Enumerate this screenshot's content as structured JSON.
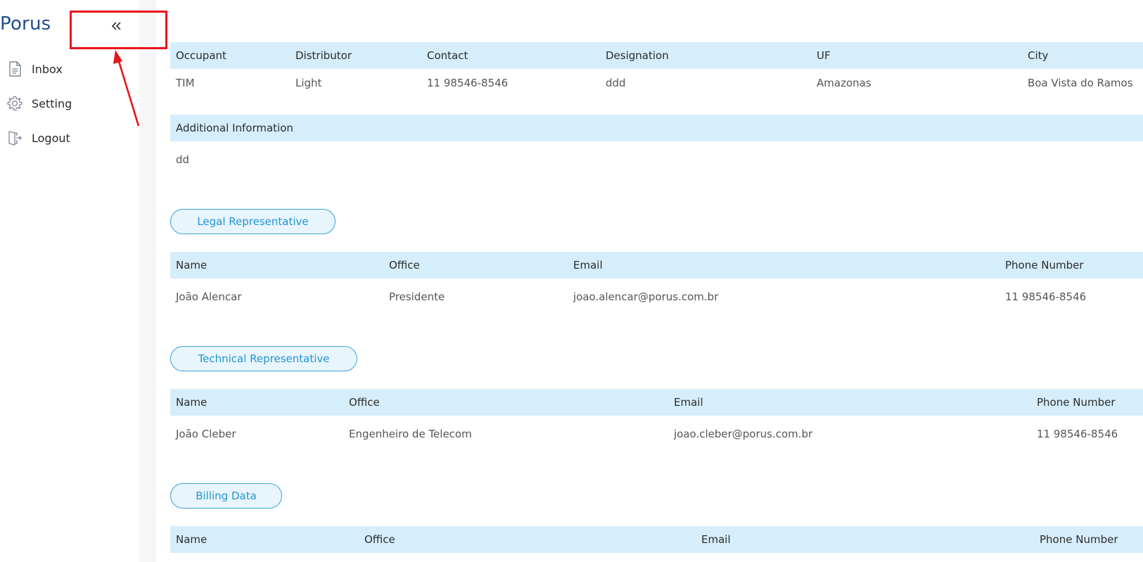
{
  "sidebar": {
    "brand": "Porus",
    "items": [
      {
        "label": "Inbox",
        "icon": "document-icon"
      },
      {
        "label": "Setting",
        "icon": "gear-icon"
      },
      {
        "label": "Logout",
        "icon": "logout-icon"
      }
    ],
    "collapse_icon": "double-chevron-left-icon"
  },
  "annotation": {
    "color": "#e8141b"
  },
  "occupant_table": {
    "headers": [
      "Occupant",
      "Distributor",
      "Contact",
      "Designation",
      "UF",
      "City"
    ],
    "row": [
      "TIM",
      "Light",
      "11 98546-8546",
      "ddd",
      "Amazonas",
      "Boa Vista do Ramos"
    ]
  },
  "additional_info": {
    "header": "Additional Information",
    "value": "dd"
  },
  "legal_representative": {
    "title": "Legal Representative",
    "headers": [
      "Name",
      "Office",
      "Email",
      "Phone Number"
    ],
    "row": [
      "João Alencar",
      "Presidente",
      "joao.alencar@porus.com.br",
      "11 98546-8546"
    ]
  },
  "technical_representative": {
    "title": "Technical Representative",
    "headers": [
      "Name",
      "Office",
      "Email",
      "Phone Number"
    ],
    "row": [
      "João Cleber",
      "Engenheiro de Telecom",
      "joao.cleber@porus.com.br",
      "11 98546-8546"
    ]
  },
  "billing_data": {
    "title": "Billing Data",
    "headers": [
      "Name",
      "Office",
      "Email",
      "Phone Number"
    ]
  },
  "colors": {
    "header_bg": "#d6eefb",
    "pill_border": "#3aa0e0",
    "pill_text": "#2196d3",
    "brand": "#1f4e8c"
  }
}
